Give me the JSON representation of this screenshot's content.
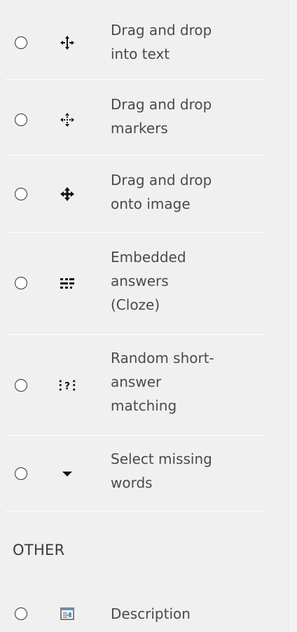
{
  "items": [
    {
      "lines": [
        "Drag and drop",
        "into text"
      ],
      "icon": "ddwtos-icon"
    },
    {
      "lines": [
        "Drag and drop",
        "markers"
      ],
      "icon": "ddmarker-icon"
    },
    {
      "lines": [
        "Drag and drop",
        "onto image"
      ],
      "icon": "ddimage-icon"
    },
    {
      "lines": [
        "Embedded",
        "answers",
        "(Cloze)"
      ],
      "icon": "multianswer-icon"
    },
    {
      "lines": [
        "Random short-",
        "answer",
        "matching"
      ],
      "icon": "randomsamatch-icon"
    },
    {
      "lines": [
        "Select missing",
        "words"
      ],
      "icon": "gapselect-icon"
    }
  ],
  "other_heading": "OTHER",
  "other_items": [
    {
      "lines": [
        "Description"
      ],
      "icon": "description-icon"
    }
  ]
}
